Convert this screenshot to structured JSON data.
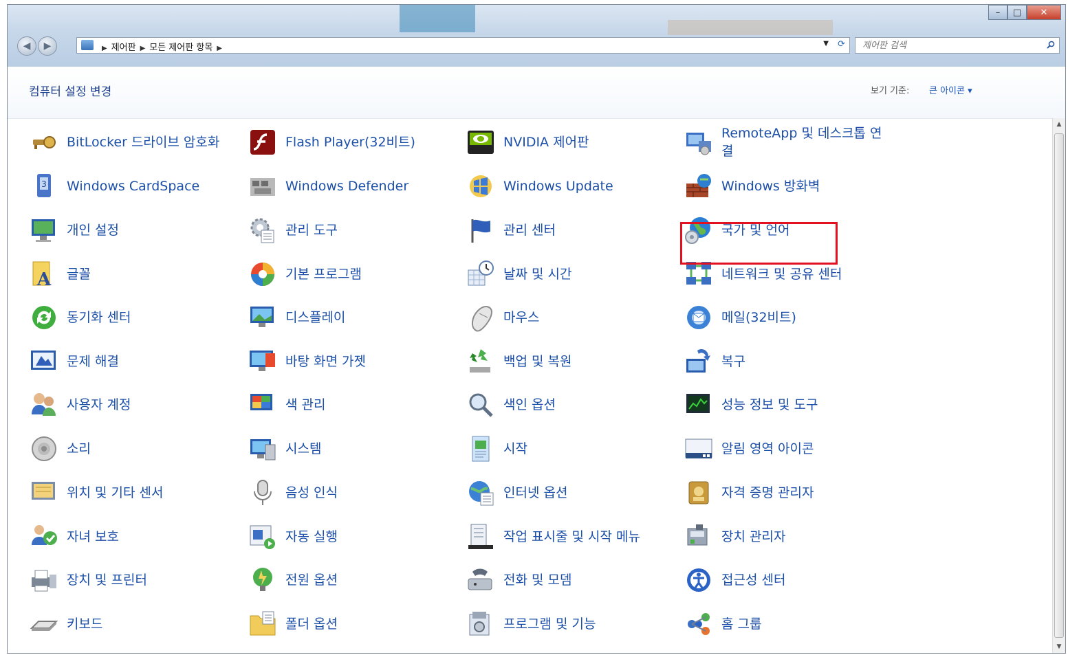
{
  "address": {
    "crumbs": [
      "제어판",
      "모든 제어판 항목"
    ],
    "search_placeholder": "제어판 검색"
  },
  "header": {
    "title": "컴퓨터 설정 변경",
    "view_by_label": "보기 기준:",
    "view_by_value": "큰 아이콘 ▾"
  },
  "highlight_color": "#e3101f",
  "link_color": "#1c4fa7",
  "items": [
    {
      "label": "BitLocker 드라이브 암호화",
      "icon": "bitlocker-key-icon"
    },
    {
      "label": "Flash Player(32비트)",
      "icon": "flash-player-icon"
    },
    {
      "label": "NVIDIA 제어판",
      "icon": "nvidia-icon"
    },
    {
      "label": "RemoteApp 및 데스크톱 연결",
      "icon": "remoteapp-icon"
    },
    {
      "label": "Windows CardSpace",
      "icon": "cardspace-icon"
    },
    {
      "label": "Windows Defender",
      "icon": "defender-icon"
    },
    {
      "label": "Windows Update",
      "icon": "windows-update-icon"
    },
    {
      "label": "Windows 방화벽",
      "icon": "firewall-icon"
    },
    {
      "label": "개인 설정",
      "icon": "personalization-icon"
    },
    {
      "label": "관리 도구",
      "icon": "admin-tools-icon"
    },
    {
      "label": "관리 센터",
      "icon": "action-center-flag-icon"
    },
    {
      "label": "국가 및 언어",
      "icon": "region-language-globe-icon"
    },
    {
      "label": "글꼴",
      "icon": "fonts-icon"
    },
    {
      "label": "기본 프로그램",
      "icon": "default-programs-icon"
    },
    {
      "label": "날짜 및 시간",
      "icon": "date-time-icon"
    },
    {
      "label": "네트워크 및 공유 센터",
      "icon": "network-icon"
    },
    {
      "label": "동기화 센터",
      "icon": "sync-center-icon"
    },
    {
      "label": "디스플레이",
      "icon": "display-icon"
    },
    {
      "label": "마우스",
      "icon": "mouse-icon"
    },
    {
      "label": "메일(32비트)",
      "icon": "mail-icon"
    },
    {
      "label": "문제 해결",
      "icon": "troubleshooting-icon"
    },
    {
      "label": "바탕 화면 가젯",
      "icon": "desktop-gadgets-icon"
    },
    {
      "label": "백업 및 복원",
      "icon": "backup-restore-icon"
    },
    {
      "label": "복구",
      "icon": "recovery-icon"
    },
    {
      "label": "사용자 계정",
      "icon": "user-accounts-icon"
    },
    {
      "label": "색 관리",
      "icon": "color-management-icon"
    },
    {
      "label": "색인 옵션",
      "icon": "indexing-options-icon"
    },
    {
      "label": "성능 정보 및 도구",
      "icon": "performance-icon"
    },
    {
      "label": "소리",
      "icon": "sound-icon"
    },
    {
      "label": "시스템",
      "icon": "system-icon"
    },
    {
      "label": "시작",
      "icon": "getting-started-icon"
    },
    {
      "label": "알림 영역 아이콘",
      "icon": "notification-area-icon"
    },
    {
      "label": "위치 및 기타 센서",
      "icon": "location-sensors-icon"
    },
    {
      "label": "음성 인식",
      "icon": "speech-recognition-icon"
    },
    {
      "label": "인터넷 옵션",
      "icon": "internet-options-icon"
    },
    {
      "label": "자격 증명 관리자",
      "icon": "credential-manager-icon"
    },
    {
      "label": "자녀 보호",
      "icon": "parental-controls-icon"
    },
    {
      "label": "자동 실행",
      "icon": "autoplay-icon"
    },
    {
      "label": "작업 표시줄 및 시작 메뉴",
      "icon": "taskbar-start-menu-icon"
    },
    {
      "label": "장치 관리자",
      "icon": "device-manager-icon"
    },
    {
      "label": "장치 및 프린터",
      "icon": "devices-printers-icon"
    },
    {
      "label": "전원 옵션",
      "icon": "power-options-icon"
    },
    {
      "label": "전화 및 모뎀",
      "icon": "phone-modem-icon"
    },
    {
      "label": "접근성 센터",
      "icon": "ease-of-access-icon"
    },
    {
      "label": "키보드",
      "icon": "keyboard-icon"
    },
    {
      "label": "폴더 옵션",
      "icon": "folder-options-icon"
    },
    {
      "label": "프로그램 및 기능",
      "icon": "programs-features-icon"
    },
    {
      "label": "홈 그룹",
      "icon": "homegroup-icon"
    }
  ]
}
